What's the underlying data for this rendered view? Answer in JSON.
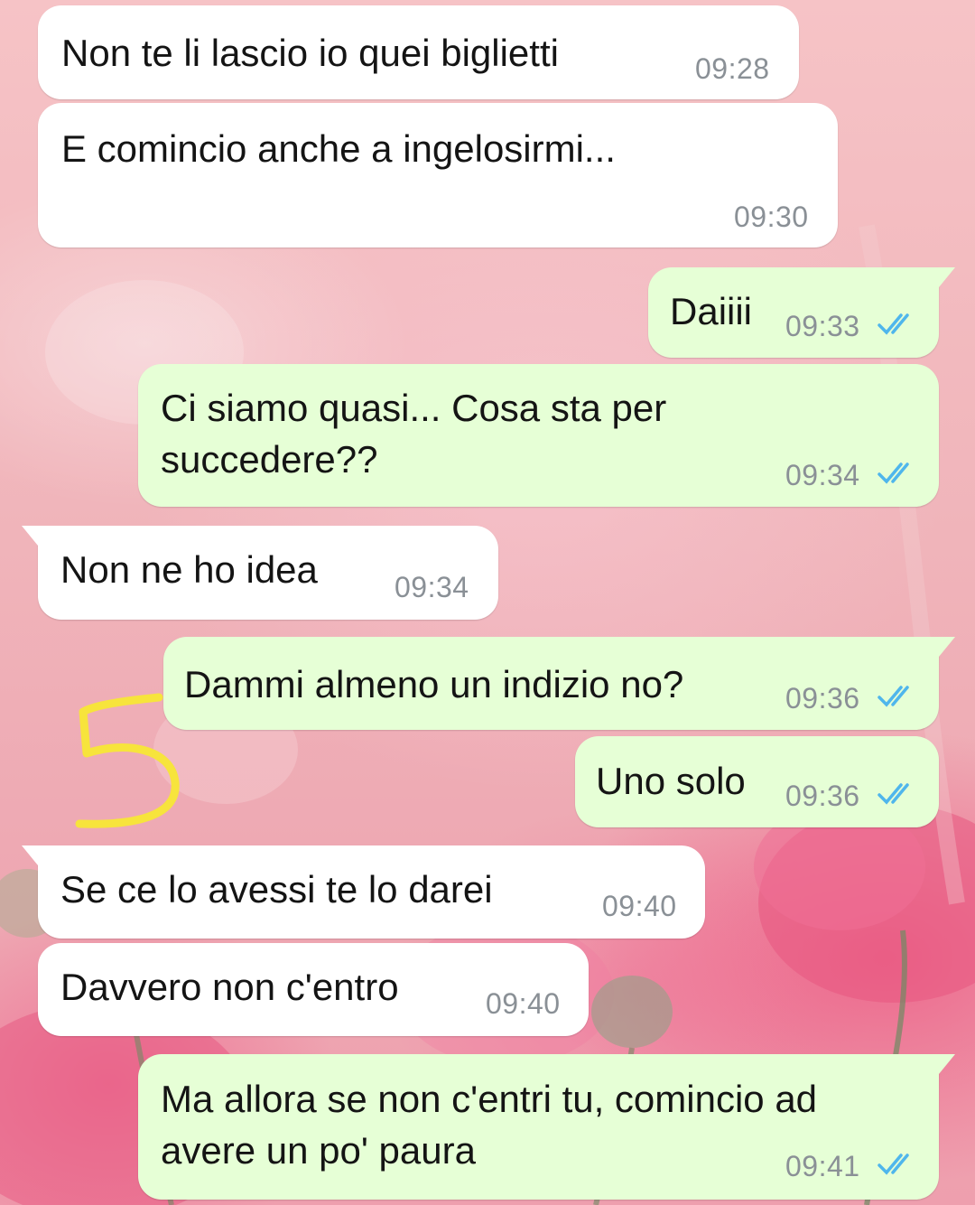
{
  "colors": {
    "incoming_bubble": "#ffffff",
    "outgoing_bubble": "#e6ffd6",
    "timestamp": "#8a9096",
    "read_ticks": "#4fb6ec",
    "annotation": "#f7e43c"
  },
  "annotation": {
    "text": "5"
  },
  "messages": [
    {
      "direction": "incoming",
      "text": "Non te li lascio io quei biglietti",
      "time": "09:28"
    },
    {
      "direction": "incoming",
      "text": "E comincio anche a ingelosirmi...",
      "time": "09:30"
    },
    {
      "direction": "outgoing",
      "text": "Daiiii",
      "time": "09:33",
      "status": "read"
    },
    {
      "direction": "outgoing",
      "text": "Ci siamo quasi... Cosa sta per\nsuccedere??",
      "time": "09:34",
      "status": "read"
    },
    {
      "direction": "incoming",
      "text": "Non ne ho idea",
      "time": "09:34"
    },
    {
      "direction": "outgoing",
      "text": "Dammi almeno un indizio no?",
      "time": "09:36",
      "status": "read"
    },
    {
      "direction": "outgoing",
      "text": "Uno solo",
      "time": "09:36",
      "status": "read"
    },
    {
      "direction": "incoming",
      "text": "Se ce lo avessi te lo darei",
      "time": "09:40"
    },
    {
      "direction": "incoming",
      "text": "Davvero non c'entro",
      "time": "09:40"
    },
    {
      "direction": "outgoing",
      "text": "Ma allora se non c'entri tu, comincio ad\navere un po' paura",
      "time": "09:41",
      "status": "read"
    }
  ]
}
